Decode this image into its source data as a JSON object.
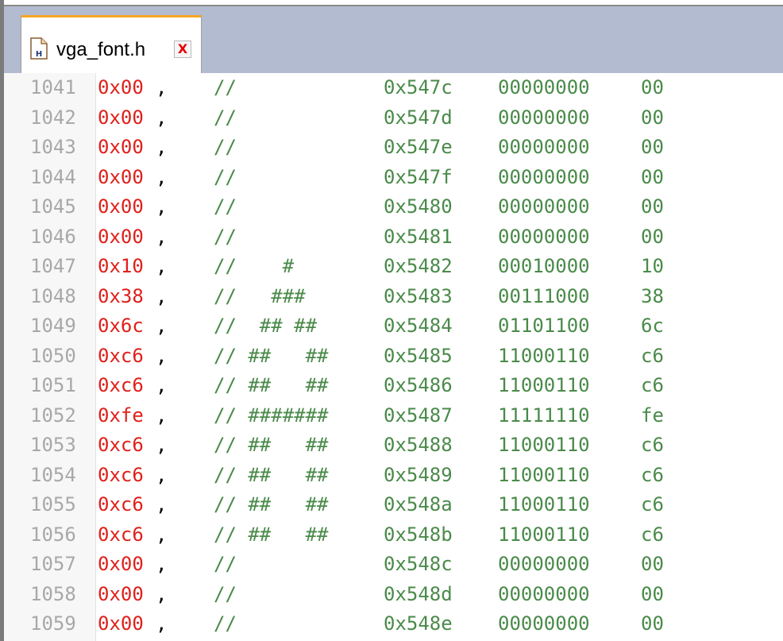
{
  "tab": {
    "filename": "vga_font.h",
    "icon": "header-file-icon",
    "close_label": "X"
  },
  "colors": {
    "tab_accent": "#f5a623",
    "tabbar_bg": "#b3bbd0",
    "hex_literal": "#e0201b",
    "comment": "#4a8a4a",
    "line_number": "#a8a8a8",
    "close": "#e60000"
  },
  "lines": [
    {
      "num": "1041",
      "hex": "0x00",
      "comma": ",",
      "comment": "//       ",
      "addr": "0x547c",
      "bits": "00000000",
      "val": "00"
    },
    {
      "num": "1042",
      "hex": "0x00",
      "comma": ",",
      "comment": "//       ",
      "addr": "0x547d",
      "bits": "00000000",
      "val": "00"
    },
    {
      "num": "1043",
      "hex": "0x00",
      "comma": ",",
      "comment": "//       ",
      "addr": "0x547e",
      "bits": "00000000",
      "val": "00"
    },
    {
      "num": "1044",
      "hex": "0x00",
      "comma": ",",
      "comment": "//       ",
      "addr": "0x547f",
      "bits": "00000000",
      "val": "00"
    },
    {
      "num": "1045",
      "hex": "0x00",
      "comma": ",",
      "comment": "//       ",
      "addr": "0x5480",
      "bits": "00000000",
      "val": "00"
    },
    {
      "num": "1046",
      "hex": "0x00",
      "comma": ",",
      "comment": "//       ",
      "addr": "0x5481",
      "bits": "00000000",
      "val": "00"
    },
    {
      "num": "1047",
      "hex": "0x10",
      "comma": ",",
      "comment": "//    #  ",
      "addr": "0x5482",
      "bits": "00010000",
      "val": "10"
    },
    {
      "num": "1048",
      "hex": "0x38",
      "comma": ",",
      "comment": "//   ### ",
      "addr": "0x5483",
      "bits": "00111000",
      "val": "38"
    },
    {
      "num": "1049",
      "hex": "0x6c",
      "comma": ",",
      "comment": "//  ## ##",
      "addr": "0x5484",
      "bits": "01101100",
      "val": "6c"
    },
    {
      "num": "1050",
      "hex": "0xc6",
      "comma": ",",
      "comment": "// ##   ##",
      "addr": "0x5485",
      "bits": "11000110",
      "val": "c6"
    },
    {
      "num": "1051",
      "hex": "0xc6",
      "comma": ",",
      "comment": "// ##   ##",
      "addr": "0x5486",
      "bits": "11000110",
      "val": "c6"
    },
    {
      "num": "1052",
      "hex": "0xfe",
      "comma": ",",
      "comment": "// #######",
      "addr": "0x5487",
      "bits": "11111110",
      "val": "fe"
    },
    {
      "num": "1053",
      "hex": "0xc6",
      "comma": ",",
      "comment": "// ##   ##",
      "addr": "0x5488",
      "bits": "11000110",
      "val": "c6"
    },
    {
      "num": "1054",
      "hex": "0xc6",
      "comma": ",",
      "comment": "// ##   ##",
      "addr": "0x5489",
      "bits": "11000110",
      "val": "c6"
    },
    {
      "num": "1055",
      "hex": "0xc6",
      "comma": ",",
      "comment": "// ##   ##",
      "addr": "0x548a",
      "bits": "11000110",
      "val": "c6"
    },
    {
      "num": "1056",
      "hex": "0xc6",
      "comma": ",",
      "comment": "// ##   ##",
      "addr": "0x548b",
      "bits": "11000110",
      "val": "c6"
    },
    {
      "num": "1057",
      "hex": "0x00",
      "comma": ",",
      "comment": "//       ",
      "addr": "0x548c",
      "bits": "00000000",
      "val": "00"
    },
    {
      "num": "1058",
      "hex": "0x00",
      "comma": ",",
      "comment": "//       ",
      "addr": "0x548d",
      "bits": "00000000",
      "val": "00"
    },
    {
      "num": "1059",
      "hex": "0x00",
      "comma": ",",
      "comment": "//       ",
      "addr": "0x548e",
      "bits": "00000000",
      "val": "00"
    }
  ]
}
